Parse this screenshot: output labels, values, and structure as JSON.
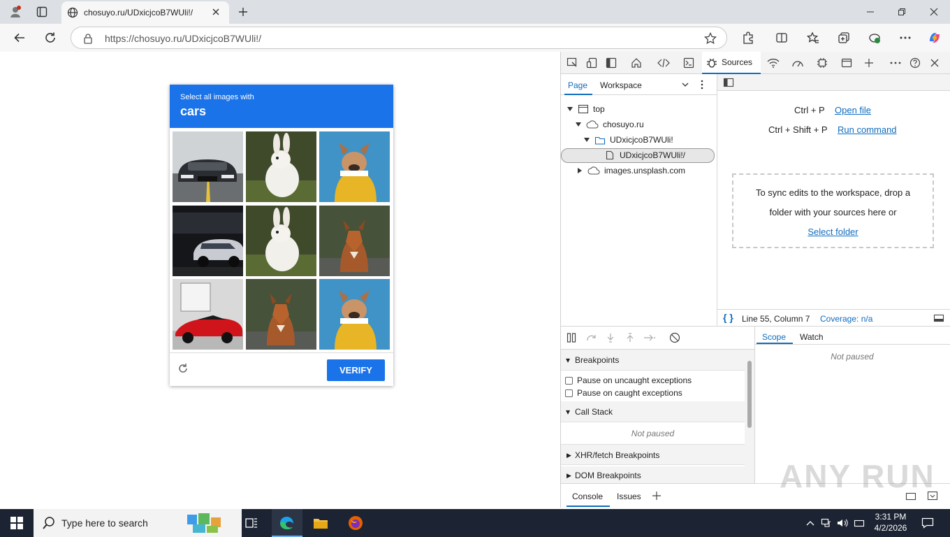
{
  "browser": {
    "tab_title": "chosuyo.ru/UDxicjcoB7WUli!/",
    "url": "https://chosuyo.ru/UDxicjcoB7WUli!/"
  },
  "captcha": {
    "instruction": "Select all images with",
    "keyword": "cars",
    "tiles": [
      {
        "subject": "car-dark-sedan"
      },
      {
        "subject": "white-rabbit"
      },
      {
        "subject": "dog-yellow-hoodie"
      },
      {
        "subject": "car-dark-garage"
      },
      {
        "subject": "white-rabbit"
      },
      {
        "subject": "fox"
      },
      {
        "subject": "car-red-sports"
      },
      {
        "subject": "fox"
      },
      {
        "subject": "dog-yellow-hoodie"
      }
    ],
    "verify_label": "VERIFY"
  },
  "devtools": {
    "active_tab": "Sources",
    "nav_tabs": [
      "Page",
      "Workspace"
    ],
    "tree": {
      "top": "top",
      "domain": "chosuyo.ru",
      "folder": "UDxicjcoB7WUli!",
      "file": "UDxicjcoB7WUli!/",
      "other": "images.unsplash.com"
    },
    "shortcuts": [
      {
        "keys": "Ctrl + P",
        "action": "Open file"
      },
      {
        "keys": "Ctrl + Shift + P",
        "action": "Run command"
      }
    ],
    "dropzone": {
      "line1": "To sync edits to the workspace, drop a",
      "line2": "folder with your sources here or",
      "link": "Select folder"
    },
    "status": {
      "position": "Line 55, Column 7",
      "coverage": "Coverage: n/a"
    },
    "debugger": {
      "breakpoints": "Breakpoints",
      "pause_uncaught": "Pause on uncaught exceptions",
      "pause_caught": "Pause on caught exceptions",
      "call_stack": "Call Stack",
      "not_paused": "Not paused",
      "xhr": "XHR/fetch Breakpoints",
      "dom": "DOM Breakpoints"
    },
    "scope_tabs": [
      "Scope",
      "Watch"
    ],
    "scope_not_paused": "Not paused",
    "drawer_tabs": [
      "Console",
      "Issues"
    ]
  },
  "taskbar": {
    "search_placeholder": "Type here to search",
    "time": "3:31 PM",
    "date": "4/2/2026"
  },
  "watermark": "ANY RUN",
  "colors": {
    "accent": "#1a73e8",
    "devtools_accent": "#0f6cbd"
  }
}
